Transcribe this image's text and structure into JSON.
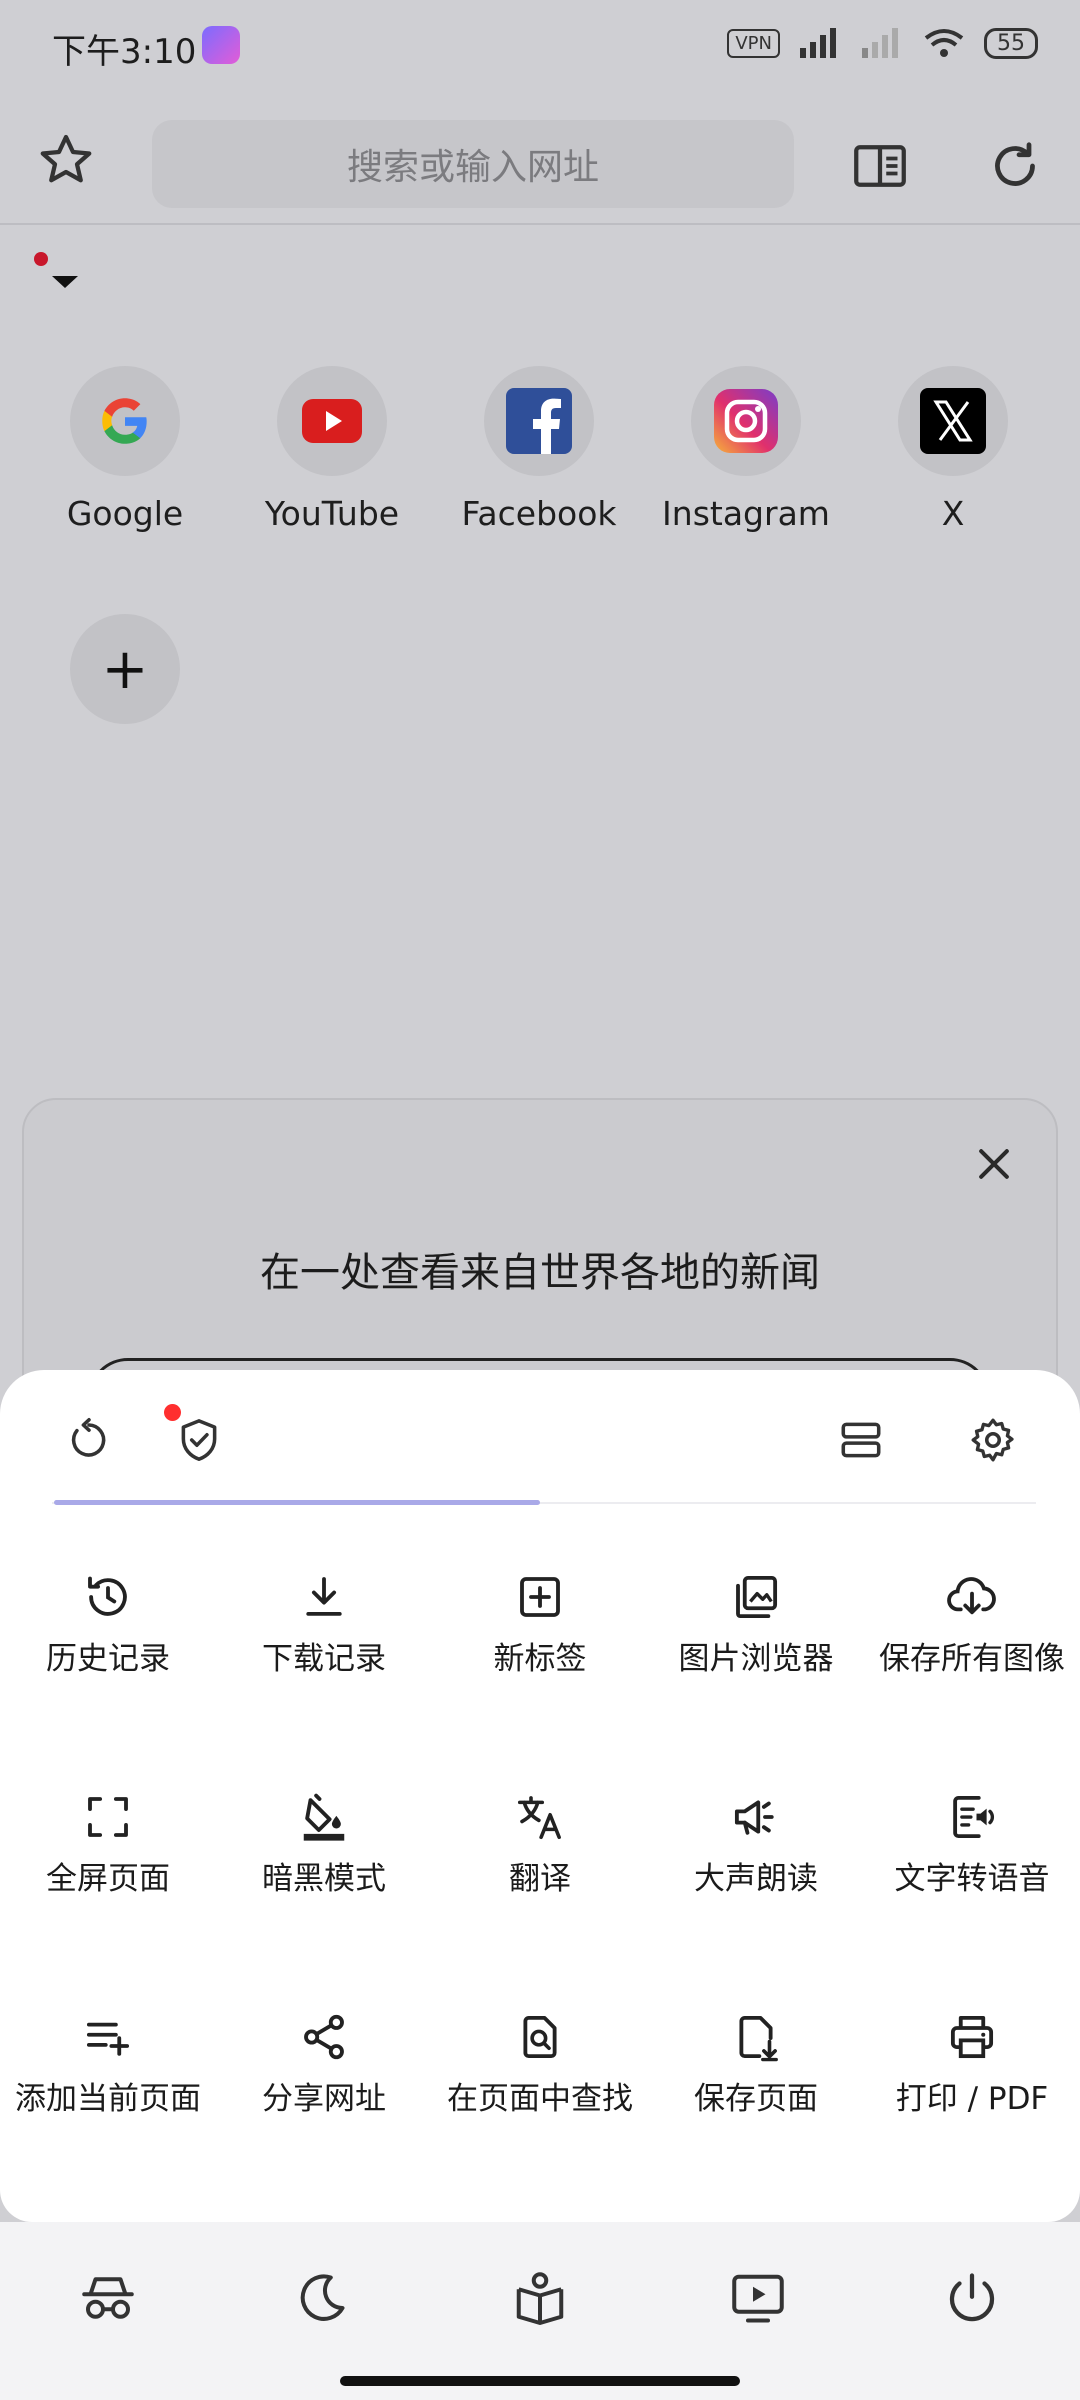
{
  "status_bar": {
    "time": "下午3:10",
    "vpn": "VPN",
    "battery": "55"
  },
  "toolbar": {
    "search_placeholder": "搜索或输入网址"
  },
  "shortcuts": [
    {
      "label": "Google"
    },
    {
      "label": "YouTube"
    },
    {
      "label": "Facebook"
    },
    {
      "label": "Instagram"
    },
    {
      "label": "X"
    }
  ],
  "add_shortcut": {
    "label": "+"
  },
  "news_card": {
    "title": "在一处查看来自世界各地的新闻"
  },
  "menu": {
    "items": [
      {
        "label": "历史记录",
        "icon": "history-icon"
      },
      {
        "label": "下载记录",
        "icon": "download-icon"
      },
      {
        "label": "新标签",
        "icon": "new-tab-icon"
      },
      {
        "label": "图片浏览器",
        "icon": "image-viewer-icon"
      },
      {
        "label": "保存所有图像",
        "icon": "cloud-download-icon"
      },
      {
        "label": "全屏页面",
        "icon": "fullscreen-icon"
      },
      {
        "label": "暗黑模式",
        "icon": "paint-bucket-icon"
      },
      {
        "label": "翻译",
        "icon": "translate-icon"
      },
      {
        "label": "大声朗读",
        "icon": "megaphone-icon"
      },
      {
        "label": "文字转语音",
        "icon": "text-to-speech-icon"
      },
      {
        "label": "添加当前页面",
        "icon": "playlist-add-icon"
      },
      {
        "label": "分享网址",
        "icon": "share-icon"
      },
      {
        "label": "在页面中查找",
        "icon": "find-in-page-icon"
      },
      {
        "label": "保存页面",
        "icon": "save-page-icon"
      },
      {
        "label": "打印 / PDF",
        "icon": "print-icon"
      }
    ]
  },
  "colors": {
    "accent_indicator": "#a9a9e8",
    "badge_red": "#ff2f2f",
    "sheet_bg": "#ffffff",
    "scrim_bg": "#cfcfd3"
  }
}
